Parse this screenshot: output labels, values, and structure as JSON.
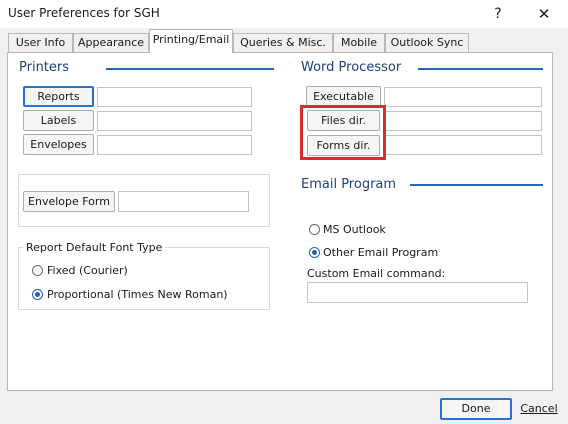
{
  "window": {
    "title": "User Preferences for SGH",
    "help_glyph": "?",
    "close_glyph": "✕"
  },
  "tabs": [
    {
      "label": "User Info",
      "active": false
    },
    {
      "label": "Appearance",
      "active": false
    },
    {
      "label": "Printing/Email",
      "active": true
    },
    {
      "label": "Queries & Misc.",
      "active": false
    },
    {
      "label": "Mobile",
      "active": false
    },
    {
      "label": "Outlook Sync",
      "active": false
    }
  ],
  "printers": {
    "heading": "Printers",
    "rows": [
      {
        "button": "Reports",
        "value": ""
      },
      {
        "button": "Labels",
        "value": ""
      },
      {
        "button": "Envelopes",
        "value": ""
      }
    ],
    "envelope_form": {
      "button": "Envelope Form",
      "value": ""
    }
  },
  "font_type": {
    "label": "Report Default Font Type",
    "options": [
      {
        "label": "Fixed (Courier)",
        "selected": false
      },
      {
        "label": "Proportional (Times New Roman)",
        "selected": true
      }
    ]
  },
  "word_processor": {
    "heading": "Word Processor",
    "rows": [
      {
        "button": "Executable",
        "value": ""
      },
      {
        "button": "Files dir.",
        "value": ""
      },
      {
        "button": "Forms dir.",
        "value": ""
      }
    ]
  },
  "email": {
    "heading": "Email Program",
    "options": [
      {
        "label": "MS Outlook",
        "selected": false
      },
      {
        "label": "Other Email Program",
        "selected": true
      }
    ],
    "command_label": "Custom Email command:",
    "command_value": ""
  },
  "footer": {
    "done": "Done",
    "cancel": "Cancel"
  },
  "colors": {
    "highlight": "#d32f2f",
    "accent": "#2a66b3"
  }
}
